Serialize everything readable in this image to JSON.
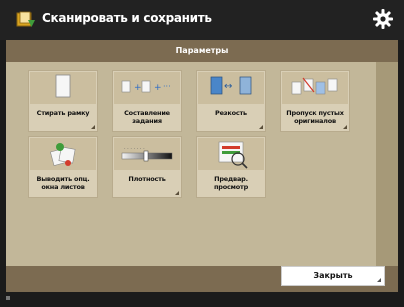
{
  "app": {
    "title": "Сканировать и сохранить",
    "header": "Параметры"
  },
  "icons": {
    "app": "scan-save-icon",
    "settings": "gear-icon"
  },
  "tiles": [
    {
      "label": "Стирать рамку",
      "icon": "erase-frame-icon"
    },
    {
      "label": "Составление задания",
      "icon": "job-build-icon"
    },
    {
      "label": "Резкость",
      "icon": "sharpness-icon"
    },
    {
      "label": "Пропуск пустых оригиналов",
      "icon": "skip-blank-originals-icon"
    },
    {
      "label": "Выводить опц. окна листов",
      "icon": "notify-sheets-icon"
    },
    {
      "label": "Плотность",
      "icon": "density-icon"
    },
    {
      "label": "Предвар. просмотр",
      "icon": "preview-icon"
    }
  ],
  "footer": {
    "close_label": "Закрыть"
  }
}
